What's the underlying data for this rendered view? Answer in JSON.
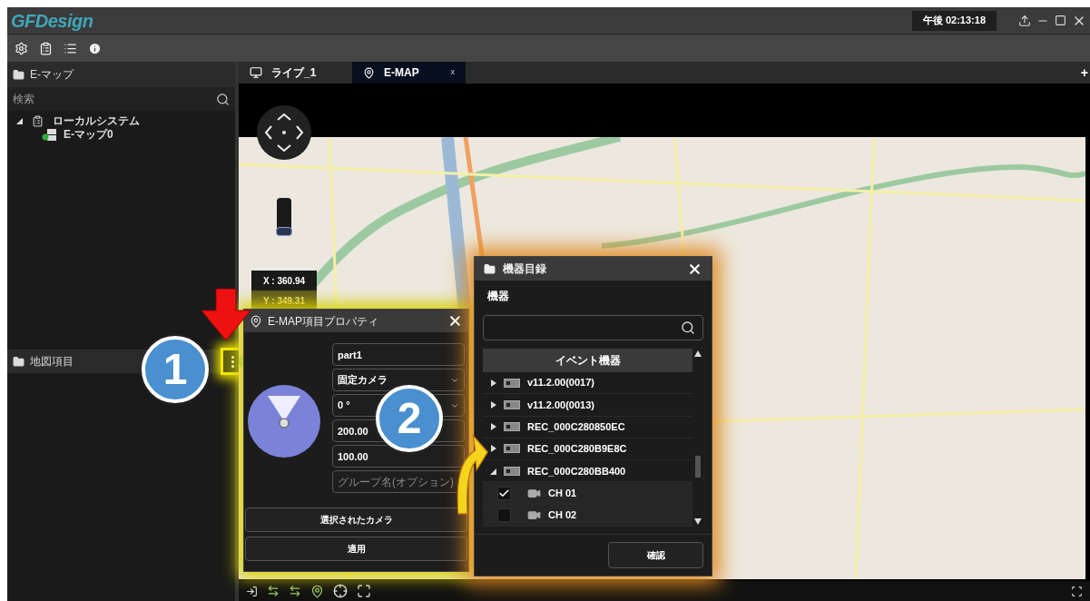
{
  "title_bar": {
    "logo": "GFDesign",
    "clock": "午後 02:13:18"
  },
  "left_panel": {
    "header": "E-マップ",
    "search": {
      "placeholder": "検索"
    },
    "tree": [
      {
        "label": "ローカルシステム",
        "expanded": true,
        "children": [
          {
            "label": "E-マップ0"
          }
        ]
      }
    ],
    "items_header": "地図項目"
  },
  "tabs": [
    {
      "label": "ライブ_1",
      "selected": false,
      "kind": "live"
    },
    {
      "label": "E-MAP",
      "selected": true,
      "kind": "map",
      "close": "x"
    }
  ],
  "add_tab": "+",
  "map": {
    "zoom": {
      "level": 0
    },
    "coords": [
      "X : 360.94",
      "Y : 349.31"
    ]
  },
  "properties_dialog": {
    "title": "E-MAP項目プロパティ",
    "fields": [
      {
        "kind": "text",
        "value": "part1"
      },
      {
        "kind": "select",
        "value": "固定カメラ"
      },
      {
        "kind": "select",
        "value": "0 °"
      },
      {
        "kind": "text",
        "value": "200.00"
      },
      {
        "kind": "text",
        "value": "100.00"
      },
      {
        "kind": "text",
        "placeholder": "グループ名(オプション)"
      }
    ],
    "buttons": [
      "選択されたカメラ",
      "適用"
    ]
  },
  "device_dialog": {
    "title": "機器目録",
    "label": "機器",
    "group": "イベント機器",
    "tree": [
      {
        "label": "v11.2.00(0017)",
        "expanded": false
      },
      {
        "label": "v11.2.00(0013)",
        "expanded": false
      },
      {
        "label": "REC_000C280850EC",
        "expanded": false
      },
      {
        "label": "REC_000C280B9E8C",
        "expanded": false
      },
      {
        "label": "REC_000C280BB400",
        "expanded": true,
        "children": [
          {
            "label": "CH 01",
            "checked": true
          },
          {
            "label": "CH 02",
            "checked": false
          }
        ]
      }
    ],
    "button": "確認"
  },
  "annotations": [
    {
      "label": "1"
    },
    {
      "label": "2"
    }
  ]
}
